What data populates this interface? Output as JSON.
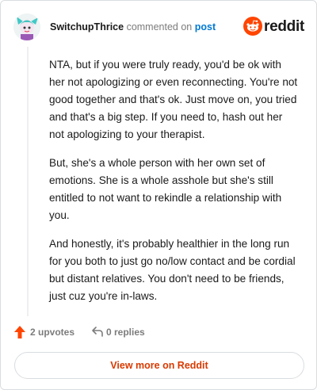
{
  "comment": {
    "author": "SwitchupThrice",
    "verb": "commented on",
    "post_link": "post",
    "paragraphs": [
      "NTA, but if you were truly ready, you'd be ok with her not apologizing or even reconnecting. You're not good together and that's ok. Just move on, you tried and that's a big step. If you need to, hash out her not apologizing to your therapist.",
      "But, she's a whole person with her own set of emotions. She is a whole asshole but she's still entitled to not want to rekindle a relationship with you.",
      "And honestly, it's probably healthier in the long run for you both to just go no/low contact and be cordial but distant relatives. You don't need to be friends, just cuz you're in-laws."
    ]
  },
  "brand": {
    "name": "reddit",
    "color": "#ff4500"
  },
  "footer": {
    "upvotes_label": "2 upvotes",
    "replies_label": "0 replies"
  },
  "view_more_label": "View more on Reddit",
  "colors": {
    "accent": "#d93a00",
    "upvote": "#ff4500",
    "link": "#0079d3"
  }
}
